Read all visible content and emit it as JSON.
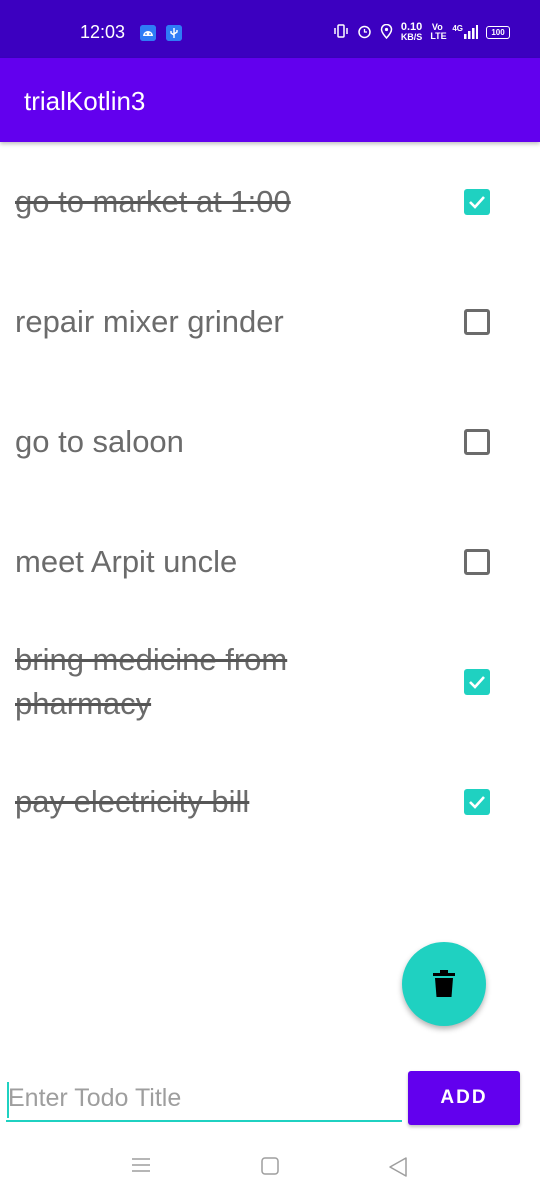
{
  "status_bar": {
    "time": "12:03",
    "data_speed_value": "0.10",
    "data_speed_unit": "KB/S",
    "volte_label": "Vo LTE",
    "network_label": "4G",
    "battery_level": "100",
    "icons": [
      "android-icon",
      "usb-debug-icon",
      "vibrate-icon",
      "alarm-icon",
      "location-icon",
      "signal-icon",
      "battery-icon"
    ]
  },
  "app_bar": {
    "title": "trialKotlin3"
  },
  "todos": [
    {
      "title": "go to market at 1:00",
      "checked": true
    },
    {
      "title": "repair mixer grinder",
      "checked": false
    },
    {
      "title": "go to saloon",
      "checked": false
    },
    {
      "title": "meet Arpit uncle",
      "checked": false
    },
    {
      "title": "bring medicine from pharmacy",
      "checked": true
    },
    {
      "title": "pay electricity bill",
      "checked": true
    }
  ],
  "fab": {
    "icon": "delete-icon"
  },
  "input": {
    "placeholder": "Enter Todo Title",
    "value": ""
  },
  "add_button": {
    "label": "ADD"
  },
  "colors": {
    "primary": "#6200ee",
    "primary_dark": "#3c00c0",
    "accent": "#1fd1c1",
    "text": "#6b6b6b"
  },
  "nav_bar": {
    "icons": [
      "menu-icon",
      "home-icon",
      "back-icon"
    ]
  }
}
